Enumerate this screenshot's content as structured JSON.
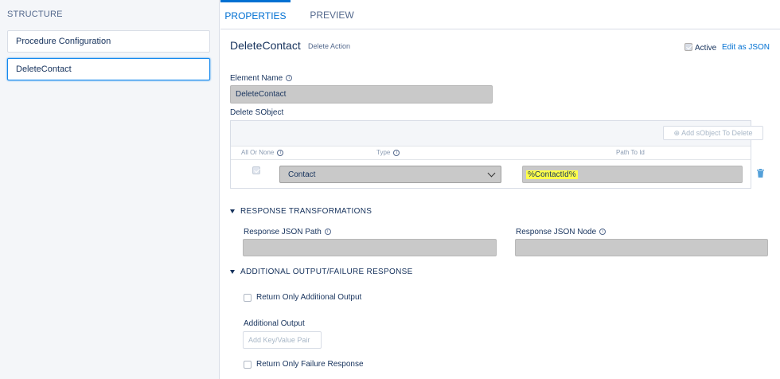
{
  "structure": {
    "header": "STRUCTURE",
    "items": [
      {
        "label": "Procedure Configuration"
      },
      {
        "label": "DeleteContact"
      }
    ]
  },
  "tabs": [
    {
      "label": "PROPERTIES",
      "active": true
    },
    {
      "label": "PREVIEW",
      "active": false
    }
  ],
  "element": {
    "title": "DeleteContact",
    "subtitle": "Delete Action",
    "active_label": "Active",
    "active_checked": true,
    "edit_json_label": "Edit as JSON"
  },
  "element_name": {
    "label": "Element Name",
    "value": "DeleteContact"
  },
  "delete_sobject": {
    "label": "Delete SObject",
    "add_button_label": "Add sObject To Delete",
    "columns": [
      "All Or None",
      "Type",
      "Path To Id"
    ],
    "row": {
      "all_or_none_checked": true,
      "type": "Contact",
      "path_to_id": "%ContactId%"
    }
  },
  "response_transformations": {
    "title": "RESPONSE TRANSFORMATIONS",
    "json_path_label": "Response JSON Path",
    "json_node_label": "Response JSON Node"
  },
  "additional_output": {
    "title": "ADDITIONAL OUTPUT/FAILURE RESPONSE",
    "return_only_additional_label": "Return Only Additional Output",
    "additional_output_label": "Additional Output",
    "kv_placeholder": "Add Key/Value Pair",
    "return_only_failure_label": "Return Only Failure Response"
  },
  "colors": {
    "accent": "#0070d2",
    "highlight": "#ffff4a",
    "input_fill": "#c9c9c9"
  }
}
